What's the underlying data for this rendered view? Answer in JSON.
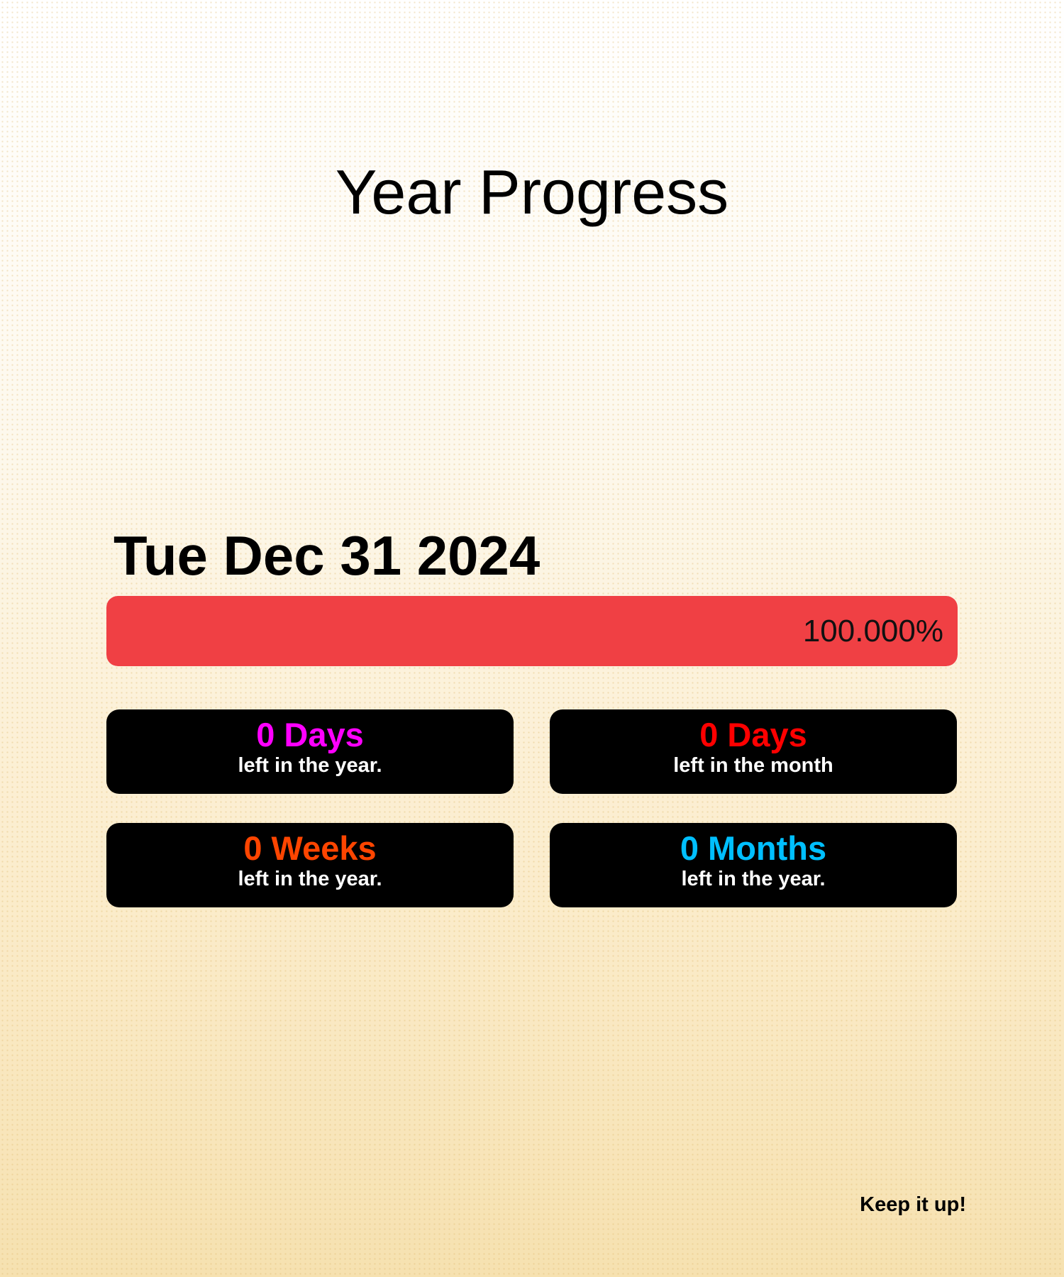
{
  "title": "Year Progress",
  "date": "Tue Dec 31 2024",
  "progress": {
    "percent": 100,
    "label": "100.000%",
    "color": "#f04044"
  },
  "cards": [
    {
      "value": "0 Days",
      "caption": "left in the year.",
      "color": "#ff00ff"
    },
    {
      "value": "0 Days",
      "caption": "left in the month",
      "color": "#ff0000"
    },
    {
      "value": "0 Weeks",
      "caption": "left in the year.",
      "color": "#ff4500"
    },
    {
      "value": "0 Months",
      "caption": "left in the year.",
      "color": "#00bfff"
    }
  ],
  "footer": "Keep it up!"
}
